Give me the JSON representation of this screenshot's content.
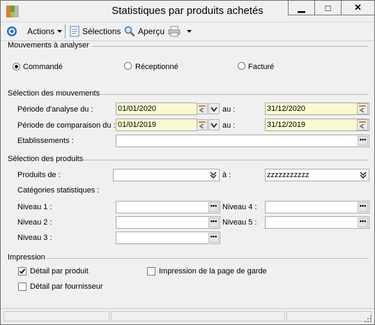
{
  "window": {
    "title": "Statistiques par produits achetés",
    "minimize": "▁",
    "maximize": "□",
    "close": "✕"
  },
  "toolbar": {
    "actions_label": "Actions",
    "selections_label": "Sélections",
    "apercu_label": "Aperçu"
  },
  "mouvements": {
    "group_label": "Mouvements à analyser",
    "options": [
      "Commandé",
      "Réceptionné",
      "Facturé"
    ],
    "selected": "Commandé"
  },
  "selection_mouvements": {
    "group_label": "Sélection des mouvements",
    "periode_analyse": {
      "label": "Période d'analyse du :",
      "from": "01/01/2020",
      "au_label": "au :",
      "to": "31/12/2020"
    },
    "periode_comparaison": {
      "label": "Période de comparaison du :",
      "from": "01/01/2019",
      "au_label": "au :",
      "to": "31/12/2019"
    },
    "etablissements": {
      "label": "Etablissements :",
      "value": ""
    }
  },
  "selection_produits": {
    "group_label": "Sélection des produits",
    "produits_label": "Produits de :",
    "produits_from": "",
    "a_label": "à :",
    "produits_to": "zzzzzzzzzzz",
    "categories_label": "Catégories statistiques :",
    "niveau1": "Niveau 1 :",
    "niveau2": "Niveau 2 :",
    "niveau3": "Niveau 3 :",
    "niveau4": "Niveau 4 :",
    "niveau5": "Niveau 5 :"
  },
  "impression": {
    "group_label": "Impression",
    "detail_produit": {
      "label": "Détail par produit",
      "checked": true
    },
    "detail_fournisseur": {
      "label": "Détail par fournisseur",
      "checked": false
    },
    "page_garde": {
      "label": "Impression de la page de garde",
      "checked": false
    }
  },
  "icons": {
    "dots": "•••"
  }
}
